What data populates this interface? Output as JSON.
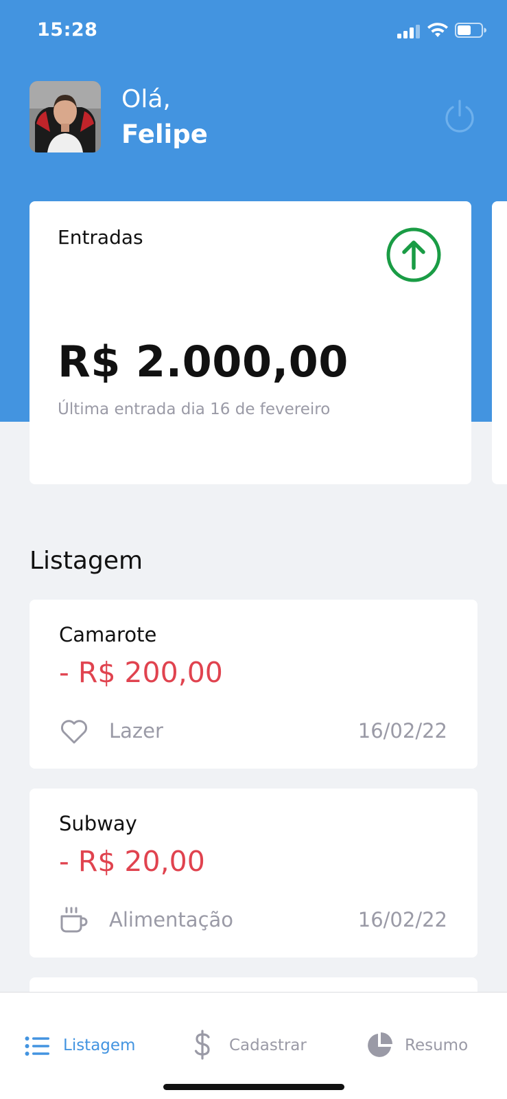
{
  "status_bar": {
    "time": "15:28",
    "icons": [
      "cellular-signal-icon",
      "wifi-icon",
      "battery-icon"
    ]
  },
  "header": {
    "greeting": "Olá,",
    "user_name": "Felipe",
    "logout_icon": "power-icon",
    "background_color": "#4394e0"
  },
  "highlight_card": {
    "title": "Entradas",
    "amount": "R$ 2.000,00",
    "subtitle": "Última entrada dia 16 de fevereiro",
    "icon": "arrow-up-circle-icon",
    "icon_color": "#1a9c45"
  },
  "listing": {
    "title": "Listagem",
    "items": [
      {
        "title": "Camarote",
        "amount": "- R$ 200,00",
        "category": "Lazer",
        "category_icon": "heart-icon",
        "date": "16/02/22"
      },
      {
        "title": "Subway",
        "amount": "- R$ 20,00",
        "category": "Alimentação",
        "category_icon": "coffee-icon",
        "date": "16/02/22"
      }
    ]
  },
  "tabbar": {
    "tabs": [
      {
        "label": "Listagem",
        "icon": "list-icon",
        "active": true
      },
      {
        "label": "Cadastrar",
        "icon": "dollar-icon",
        "active": false
      },
      {
        "label": "Resumo",
        "icon": "pie-chart-icon",
        "active": false
      }
    ],
    "active_color": "#4394e0",
    "inactive_color": "#9a9aa6"
  },
  "colors": {
    "expense": "#e0434f",
    "muted_text": "#9a9aa6",
    "page_background": "#f0f2f5"
  }
}
